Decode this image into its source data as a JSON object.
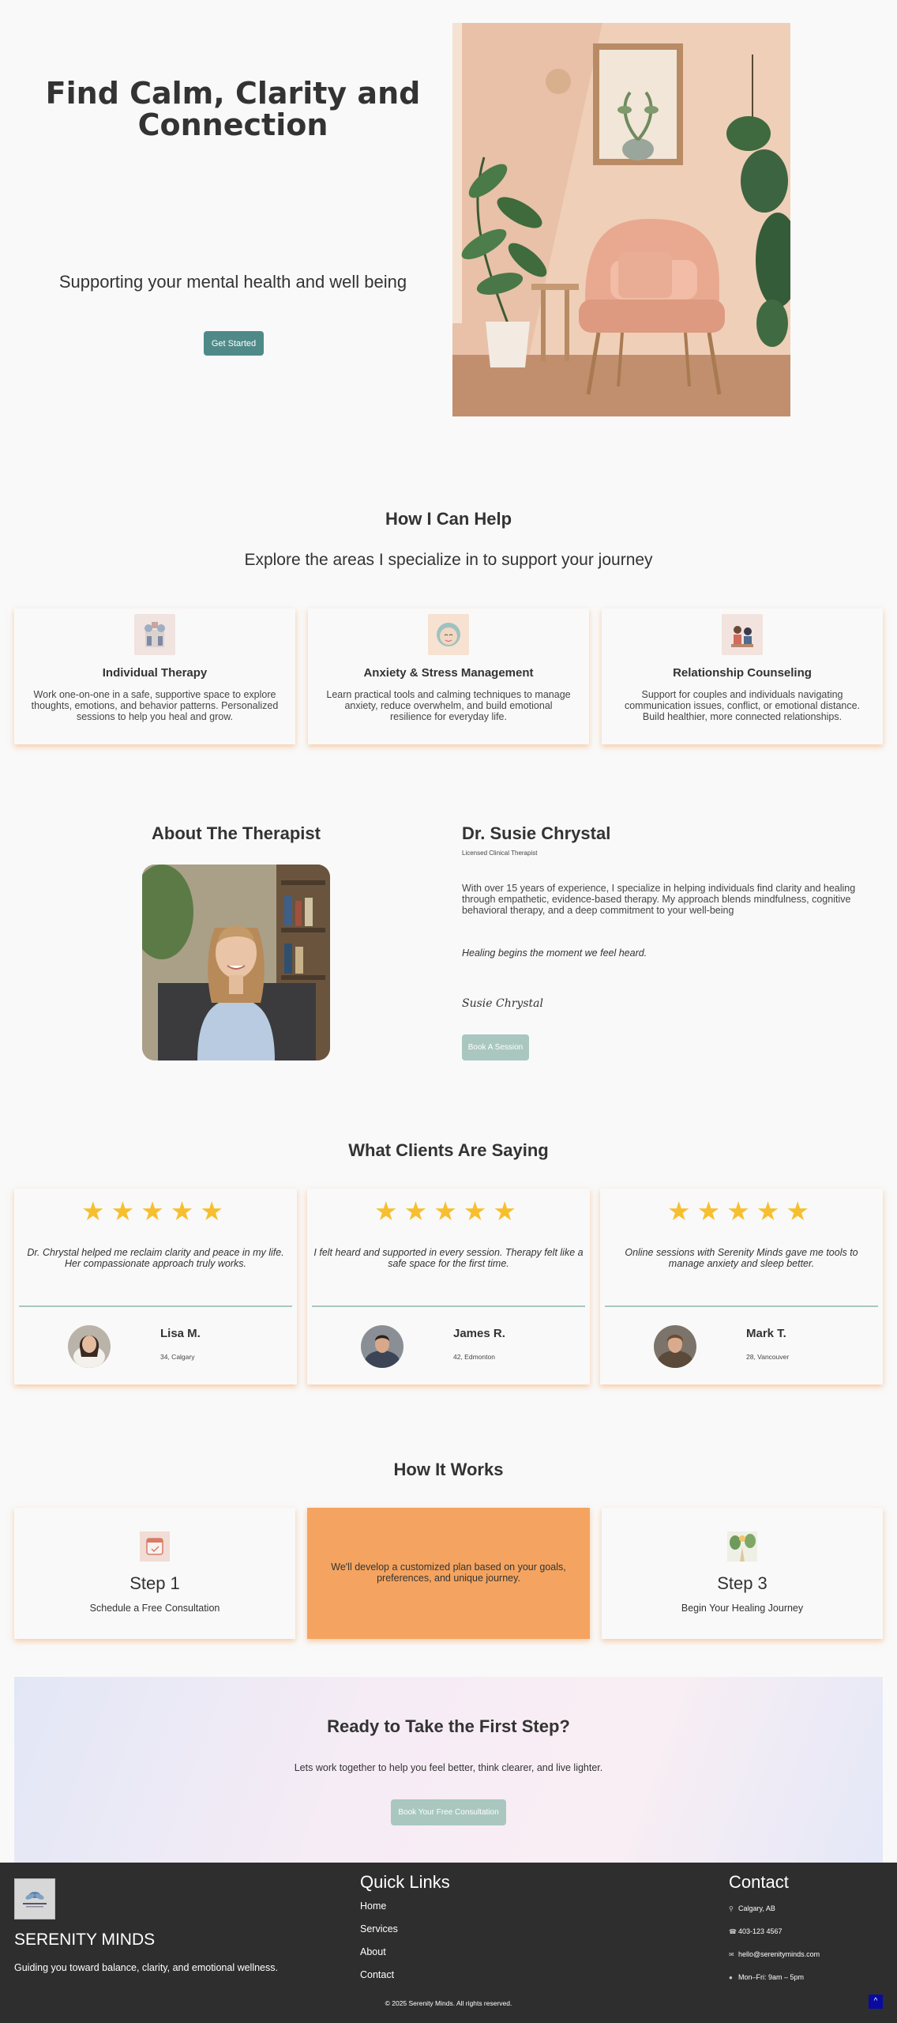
{
  "hero": {
    "title": "Find Calm, Clarity and Connection",
    "subtitle": "Supporting your mental health and well being",
    "cta": "Get Started"
  },
  "services": {
    "title": "How I Can Help",
    "subtitle": "Explore the areas I specialize in to support your journey",
    "items": [
      {
        "title": "Individual Therapy",
        "desc": "Work one-on-one in a safe, supportive space to explore thoughts, emotions, and behavior patterns. Personalized sessions to help you heal and grow.",
        "icon": "therapy-illustration-icon"
      },
      {
        "title": "Anxiety & Stress Management",
        "desc": "Learn practical tools and calming techniques to manage anxiety, reduce overwhelm, and build emotional resilience for everyday life.",
        "icon": "calm-face-illustration-icon"
      },
      {
        "title": "Relationship Counseling",
        "desc": "Support for couples and individuals navigating communication issues, conflict, or emotional distance. Build healthier, more connected relationships.",
        "icon": "couple-illustration-icon"
      }
    ]
  },
  "about": {
    "title": "About The Therapist",
    "name": "Dr. Susie Chrystal",
    "credential": "Licensed Clinical Therapist",
    "bio": "With over 15 years of experience, I specialize in helping individuals find clarity and healing through empathetic, evidence-based therapy. My approach blends mindfulness, cognitive behavioral therapy, and a deep commitment to your well-being",
    "quote": "Healing begins the moment we feel heard.",
    "signature": "Susie Chrystal",
    "cta": "Book A Session"
  },
  "testimonials": {
    "title": "What Clients Are Saying",
    "stars": "★★★★★",
    "items": [
      {
        "quote": "Dr. Chrystal helped me reclaim clarity and peace in my life. Her compassionate approach truly works.",
        "name": "Lisa M.",
        "meta": "34, Calgary"
      },
      {
        "quote": "I felt heard and supported in every session. Therapy felt like a safe space for the first time.",
        "name": "James R.",
        "meta": "42, Edmonton"
      },
      {
        "quote": "Online sessions with Serenity Minds gave me tools to manage anxiety and sleep better.",
        "name": "Mark T.",
        "meta": "28, Vancouver"
      }
    ]
  },
  "how": {
    "title": "How It Works",
    "steps": [
      {
        "title": "Step 1",
        "desc": "Schedule a Free Consultation",
        "icon": "calendar-icon"
      },
      {
        "hover_text": "We'll develop a customized plan based on your goals, preferences, and unique journey."
      },
      {
        "title": "Step 3",
        "desc": "Begin Your Healing Journey",
        "icon": "nature-path-icon"
      }
    ]
  },
  "cta": {
    "title": "Ready to Take the First Step?",
    "text": "Lets work together to help you feel better, think clearer, and live lighter.",
    "button": "Book Your Free Consultation"
  },
  "footer": {
    "brand": "SERENITY MINDS",
    "tagline": "Guiding you toward balance, clarity, and emotional wellness.",
    "quick_links_title": "Quick Links",
    "links": [
      "Home",
      "Services",
      "About",
      "Contact"
    ],
    "contact_title": "Contact",
    "contact": {
      "location": "Calgary, AB",
      "phone": "403-123 4567",
      "email": "hello@serenityminds.com",
      "hours": "Mon–Fri: 9am – 5pm"
    },
    "copyright": "© 2025 Serenity Minds. All rights reserved.",
    "back_to_top": "^"
  },
  "colors": {
    "accent": "#4f8a88",
    "accent_light": "#a9c7bf",
    "card_shadow": "#f4a460",
    "star": "#f7bf2e",
    "footer_bg": "#2e2e2e"
  }
}
